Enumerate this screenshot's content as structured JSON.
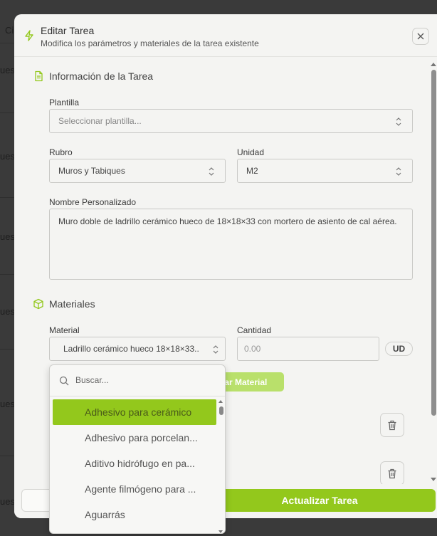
{
  "modal": {
    "title": "Editar Tarea",
    "subtitle": "Modifica los parámetros y materiales de la tarea existente",
    "accent": "#93c81c"
  },
  "info_section": {
    "title": "Información de la Tarea",
    "plantilla_label": "Plantilla",
    "plantilla_placeholder": "Seleccionar plantilla...",
    "rubro_label": "Rubro",
    "rubro_value": "Muros y Tabiques",
    "unidad_label": "Unidad",
    "unidad_value": "M2",
    "nombre_label": "Nombre Personalizado",
    "nombre_value": "Muro doble de ladrillo cerámico hueco de 18×18×33 con mortero de asiento de cal aérea."
  },
  "materials_section": {
    "title": "Materiales",
    "material_label": "Material",
    "material_value": "Ladrillo cerámico hueco 18×18×33..",
    "cantidad_label": "Cantidad",
    "cantidad_placeholder": "0.00",
    "unit_badge": "UD",
    "add_button_label": "gar Material"
  },
  "dropdown": {
    "search_placeholder": "Buscar...",
    "items": [
      "Adhesivo para cerámico",
      "Adhesivo para porcelan...",
      "Aditivo hidrófugo en pa...",
      "Agente filmógeno para ...",
      "Aguarrás"
    ],
    "selected_index": 0
  },
  "footer": {
    "update_button_label": "Actualizar Tarea"
  },
  "background": {
    "row_fragments": [
      "Ci",
      "ues",
      "ues",
      "ues",
      "ues",
      "ues",
      "ues"
    ]
  }
}
